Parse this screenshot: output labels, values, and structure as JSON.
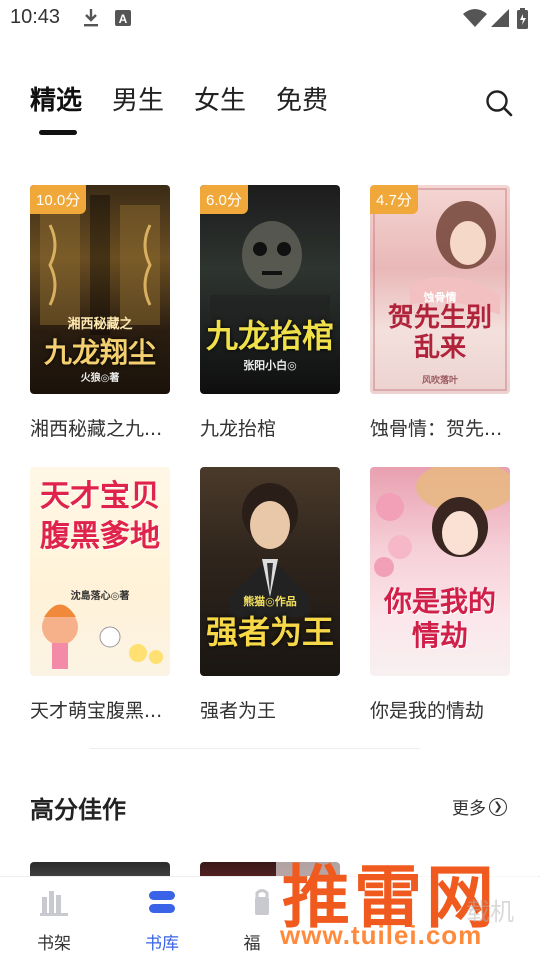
{
  "status_bar": {
    "time": "10:43",
    "icons": [
      "download-icon",
      "text-a-icon",
      "wifi-icon",
      "signal-icon",
      "battery-icon"
    ]
  },
  "tabs": [
    {
      "label": "精选",
      "active": true
    },
    {
      "label": "男生",
      "active": false
    },
    {
      "label": "女生",
      "active": false
    },
    {
      "label": "免费",
      "active": false
    }
  ],
  "search_icon": "search-icon",
  "books": [
    {
      "title": "湘西秘藏之九...",
      "score": "10.0分",
      "cover_title": "九龙翔尘",
      "cover_top": "湘西秘藏之",
      "cover_author": "火狼◎著"
    },
    {
      "title": "九龙抬棺",
      "score": "6.0分",
      "cover_title": "九龙抬棺",
      "cover_author": "张阳小白◎"
    },
    {
      "title": "蚀骨情：贺先...",
      "score": "4.7分",
      "cover_title": "贺先生别乱来",
      "cover_top": "蚀骨情",
      "cover_author": "风吹落叶"
    },
    {
      "title": "天才萌宝腹黑...",
      "cover_title": "天才宝贝腹黑爹地",
      "cover_author": "沈島落心◎著"
    },
    {
      "title": "强者为王",
      "cover_title": "强者为王",
      "cover_top": "熊猫◎作品"
    },
    {
      "title": "你是我的情劫",
      "cover_title": "你是我的情劫"
    }
  ],
  "section": {
    "title": "高分佳作",
    "more_label": "更多"
  },
  "bottom_nav": [
    {
      "label": "书架",
      "icon": "bookshelf-icon",
      "active": false
    },
    {
      "label": "书库",
      "icon": "library-icon",
      "active": true
    },
    {
      "label": "福",
      "icon": "gift-icon",
      "active": false
    }
  ],
  "watermark": {
    "main": "推雷网",
    "sub": "www.tuilei.com",
    "faint": "载机"
  },
  "colors": {
    "accent": "#3a63e8",
    "score_badge": "#f1a83a",
    "watermark": "#f05a1e"
  }
}
